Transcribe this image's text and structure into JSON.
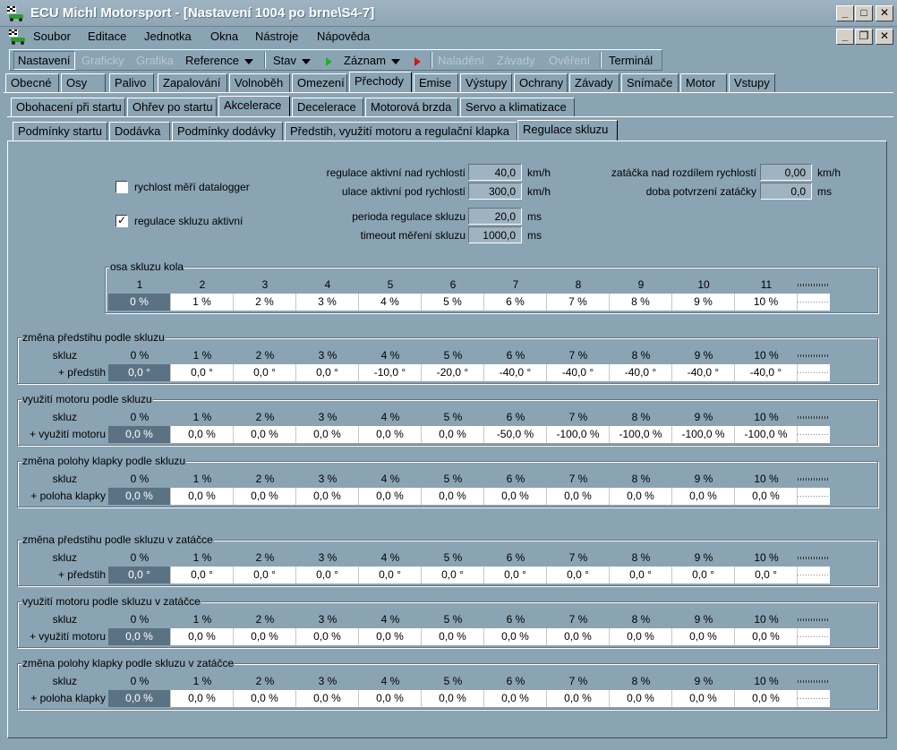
{
  "window": {
    "title": "ECU Michl Motorsport - [Nastavení  1004 po brne\\S4-7]"
  },
  "menu": [
    "Soubor",
    "Editace",
    "Jednotka",
    "Okna",
    "Nástroje",
    "Nápověda"
  ],
  "toolbar": {
    "nastaveni": "Nastavení",
    "graficky": "Graficky",
    "grafika": "Grafika",
    "reference": "Reference",
    "stav": "Stav",
    "zaznam": "Záznam",
    "naladeni": "Naladění",
    "zavady": "Závady",
    "overeni": "Ověření",
    "terminal": "Terminál"
  },
  "tabs_main": [
    "Obecné",
    "Osy",
    "Palivo",
    "Zapalování",
    "Volnoběh",
    "Omezení",
    "Přechody",
    "Emise",
    "Výstupy",
    "Ochrany",
    "Závady",
    "Snímače",
    "Motor",
    "Vstupy"
  ],
  "tabs_sub": [
    "Obohacení při startu",
    "Ohřev po startu",
    "Akcelerace",
    "Decelerace",
    "Motorová brzda",
    "Servo a klimatizace"
  ],
  "tabs_sub2": [
    "Podmínky startu",
    "Dodávka",
    "Podmínky dodávky",
    "Předstih, využití motoru a regulační klapka",
    "Regulace skluzu"
  ],
  "options": {
    "datalogger_label": "rychlost měří datalogger",
    "datalogger_checked": false,
    "regulace_label": "regulace skluzu aktivní",
    "regulace_checked": true,
    "regulace_check_mark": "✓"
  },
  "params": {
    "p1_label": "regulace aktivní nad rychlostí",
    "p1_value": "40,0",
    "p1_unit": "km/h",
    "p2_label": "ulace aktivní pod rychlostí",
    "p2_value": "300,0",
    "p2_unit": "km/h",
    "p3_label": "perioda regulace skluzu",
    "p3_value": "20,0",
    "p3_unit": "ms",
    "p4_label": "timeout měření skluzu",
    "p4_value": "1000,0",
    "p4_unit": "ms",
    "p5_label": "zatáčka nad rozdílem rychlostí",
    "p5_value": "0,00",
    "p5_unit": "km/h",
    "p6_label": "doba potvrzení zatáčky",
    "p6_value": "0,0",
    "p6_unit": "ms"
  },
  "axis": {
    "title": "osa skluzu kola",
    "indices": [
      "1",
      "2",
      "3",
      "4",
      "5",
      "6",
      "7",
      "8",
      "9",
      "10",
      "11"
    ],
    "values": [
      "0 %",
      "1 %",
      "2 %",
      "3 %",
      "4 %",
      "5 %",
      "6 %",
      "7 %",
      "8 %",
      "9 %",
      "10 %"
    ]
  },
  "tables": [
    {
      "title": "změna předstihu podle skluzu",
      "hdr_label": "skluz",
      "row_label": "+ předstih",
      "headers": [
        "0 %",
        "1 %",
        "2 %",
        "3 %",
        "4 %",
        "5 %",
        "6 %",
        "7 %",
        "8 %",
        "9 %",
        "10 %"
      ],
      "values": [
        "0,0 °",
        "0,0 °",
        "0,0 °",
        "0,0 °",
        "-10,0 °",
        "-20,0 °",
        "-40,0 °",
        "-40,0 °",
        "-40,0 °",
        "-40,0 °",
        "-40,0 °"
      ]
    },
    {
      "title": "využití motoru podle skluzu",
      "hdr_label": "skluz",
      "row_label": "+ využití motoru",
      "headers": [
        "0 %",
        "1 %",
        "2 %",
        "3 %",
        "4 %",
        "5 %",
        "6 %",
        "7 %",
        "8 %",
        "9 %",
        "10 %"
      ],
      "values": [
        "0,0 %",
        "0,0 %",
        "0,0 %",
        "0,0 %",
        "0,0 %",
        "0,0 %",
        "-50,0 %",
        "-100,0 %",
        "-100,0 %",
        "-100,0 %",
        "-100,0 %"
      ]
    },
    {
      "title": "změna polohy klapky podle skluzu",
      "hdr_label": "skluz",
      "row_label": "+ poloha klapky",
      "headers": [
        "0 %",
        "1 %",
        "2 %",
        "3 %",
        "4 %",
        "5 %",
        "6 %",
        "7 %",
        "8 %",
        "9 %",
        "10 %"
      ],
      "values": [
        "0,0 %",
        "0,0 %",
        "0,0 %",
        "0,0 %",
        "0,0 %",
        "0,0 %",
        "0,0 %",
        "0,0 %",
        "0,0 %",
        "0,0 %",
        "0,0 %"
      ]
    },
    {
      "title": "změna předstihu podle skluzu v zatáčce",
      "hdr_label": "skluz",
      "row_label": "+ předstih",
      "headers": [
        "0 %",
        "1 %",
        "2 %",
        "3 %",
        "4 %",
        "5 %",
        "6 %",
        "7 %",
        "8 %",
        "9 %",
        "10 %"
      ],
      "values": [
        "0,0 °",
        "0,0 °",
        "0,0 °",
        "0,0 °",
        "0,0 °",
        "0,0 °",
        "0,0 °",
        "0,0 °",
        "0,0 °",
        "0,0 °",
        "0,0 °"
      ]
    },
    {
      "title": "využití motoru podle skluzu v zatáčce",
      "hdr_label": "skluz",
      "row_label": "+ využití motoru",
      "headers": [
        "0 %",
        "1 %",
        "2 %",
        "3 %",
        "4 %",
        "5 %",
        "6 %",
        "7 %",
        "8 %",
        "9 %",
        "10 %"
      ],
      "values": [
        "0,0 %",
        "0,0 %",
        "0,0 %",
        "0,0 %",
        "0,0 %",
        "0,0 %",
        "0,0 %",
        "0,0 %",
        "0,0 %",
        "0,0 %",
        "0,0 %"
      ]
    },
    {
      "title": "změna polohy klapky podle skluzu v zatáčce",
      "hdr_label": "skluz",
      "row_label": "+ poloha klapky",
      "headers": [
        "0 %",
        "1 %",
        "2 %",
        "3 %",
        "4 %",
        "5 %",
        "6 %",
        "7 %",
        "8 %",
        "9 %",
        "10 %"
      ],
      "values": [
        "0,0 %",
        "0,0 %",
        "0,0 %",
        "0,0 %",
        "0,0 %",
        "0,0 %",
        "0,0 %",
        "0,0 %",
        "0,0 %",
        "0,0 %",
        "0,0 %"
      ]
    }
  ]
}
